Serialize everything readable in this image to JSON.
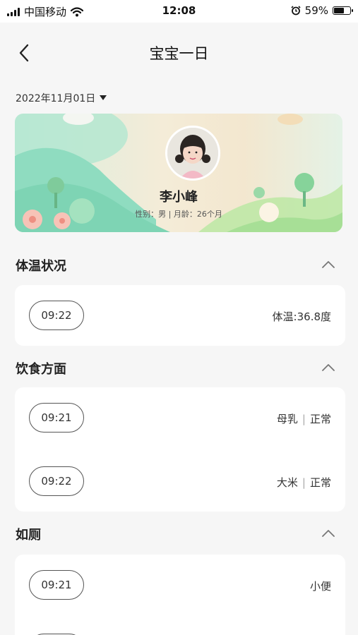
{
  "status_bar": {
    "carrier": "中国移动",
    "time": "12:08",
    "battery_pct": "59%",
    "battery_level": 0.59
  },
  "nav": {
    "title": "宝宝一日"
  },
  "date": {
    "value": "2022年11月01日"
  },
  "profile": {
    "name": "李小峰",
    "info": "性别：男 | 月龄：26个月"
  },
  "sections": {
    "temperature": {
      "title": "体温状况",
      "rows": [
        {
          "time": "09:22",
          "value": "体温:36.8度"
        }
      ]
    },
    "diet": {
      "title": "饮食方面",
      "rows": [
        {
          "time": "09:21",
          "food": "母乳",
          "status": "正常"
        },
        {
          "time": "09:22",
          "food": "大米",
          "status": "正常"
        }
      ]
    },
    "toilet": {
      "title": "如厕",
      "rows": [
        {
          "time": "09:21",
          "value": "小便"
        },
        {
          "time": ""
        }
      ]
    }
  },
  "colors": {
    "background": "#f6f6f6",
    "card": "#ffffff",
    "chip_border": "#555555"
  },
  "separator": "|"
}
